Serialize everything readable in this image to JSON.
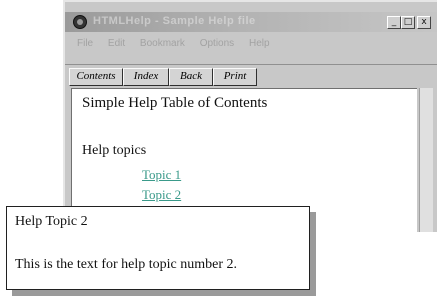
{
  "window": {
    "title": "HTMLHelp - Sample Help file",
    "controls": {
      "minimize": "_",
      "maximize": "□",
      "close": "x"
    }
  },
  "menu": {
    "items": [
      "File",
      "Edit",
      "Bookmark",
      "Options",
      "Help"
    ]
  },
  "toolbar": {
    "contents": "Contents",
    "index": "Index",
    "back": "Back",
    "print": "Print"
  },
  "content": {
    "heading": "Simple Help Table of Contents",
    "subheading": "Help topics",
    "links": [
      "Topic 1",
      "Topic 2"
    ]
  },
  "popup": {
    "title": "Help Topic 2",
    "body": "This is the text for help topic number 2."
  }
}
